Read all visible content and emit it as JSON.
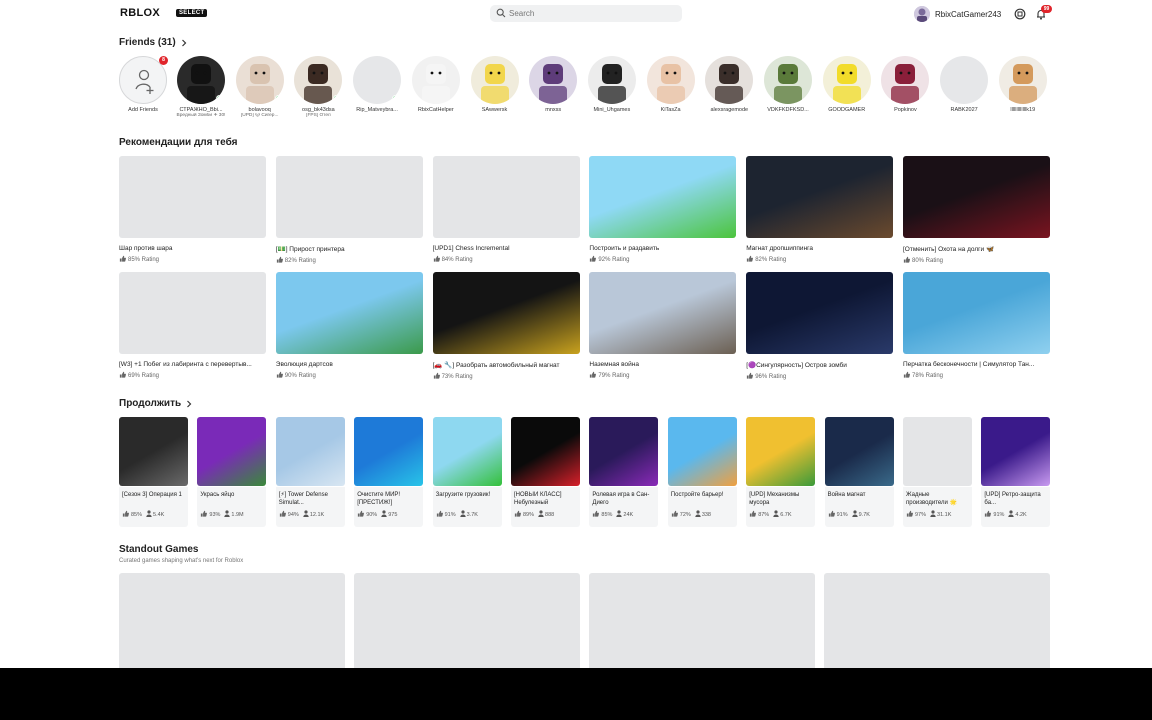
{
  "header": {
    "logo": "RBLOX",
    "logo_badge": "SELECT",
    "search_placeholder": "Search",
    "username": "RbixCatGamer243",
    "notification_count": "99"
  },
  "friends": {
    "title": "Friends (31)",
    "add_label": "Add Friends",
    "add_badge": "8",
    "items": [
      {
        "name": "СТРАЖНО_Bbi...",
        "status": "Вредный Зомби ✈ 30!",
        "online": true,
        "bg": "#2a2a2a",
        "face": "#111"
      },
      {
        "name": "bolavooq",
        "status": "[UPD] 🐱 Сигер...",
        "online": true,
        "bg": "#eadfd5",
        "face": "#d9c3b0"
      },
      {
        "name": "osg_bk43dsa",
        "status": "[FPS] Отел",
        "online": true,
        "bg": "#e9e2d8",
        "face": "#3b2a22"
      },
      {
        "name": "Rip_Matveybra...",
        "status": "",
        "online": true,
        "bg": "#e6e7e9",
        "face": "#e6e7e9"
      },
      {
        "name": "RbixCatHelper",
        "status": "",
        "online": false,
        "bg": "#f1f1f1",
        "face": "#f5f5f5"
      },
      {
        "name": "SAwwersk",
        "status": "",
        "online": false,
        "bg": "#f0ecdc",
        "face": "#f2d64b"
      },
      {
        "name": "mnxss",
        "status": "",
        "online": false,
        "bg": "#dcd6e6",
        "face": "#5e3c7a"
      },
      {
        "name": "Mini_Uhgames",
        "status": "",
        "online": false,
        "bg": "#ececec",
        "face": "#222"
      },
      {
        "name": "KiTasZa",
        "status": "",
        "online": false,
        "bg": "#f2e5dc",
        "face": "#e8c2a5"
      },
      {
        "name": "alexsragemode",
        "status": "",
        "online": false,
        "bg": "#e5e0dc",
        "face": "#3a2e2a"
      },
      {
        "name": "VDKFKDFKSD...",
        "status": "",
        "online": false,
        "bg": "#dde6d7",
        "face": "#5a7a3a"
      },
      {
        "name": "GOODGAMER",
        "status": "",
        "online": false,
        "bg": "#f3f0d8",
        "face": "#f2dc2a"
      },
      {
        "name": "Popkinov",
        "status": "",
        "online": false,
        "bg": "#efe2e6",
        "face": "#8a1f3a"
      },
      {
        "name": "RABK2027",
        "status": "",
        "online": false,
        "bg": "#e6e7e9",
        "face": "#e6e7e9"
      },
      {
        "name": "lllllllllllllk19",
        "status": "",
        "online": false,
        "bg": "#f0ece4",
        "face": "#d49a5c"
      }
    ]
  },
  "recommended": {
    "title": "Рекомендации для тебя",
    "items": [
      {
        "title": "Шар против шара",
        "rating": "85% Rating",
        "c1": "#e4e5e7",
        "c2": "#e4e5e7"
      },
      {
        "title": "[💵] Прирост принтера",
        "rating": "82% Rating",
        "c1": "#e4e5e7",
        "c2": "#e4e5e7"
      },
      {
        "title": "[UPD1] Chess Incremental",
        "rating": "84% Rating",
        "c1": "#e4e5e7",
        "c2": "#e4e5e7"
      },
      {
        "title": "Построить и раздавить",
        "rating": "92% Rating",
        "c1": "#8fd9f5",
        "c2": "#4cc43c"
      },
      {
        "title": "Магнат дропшиппинга",
        "rating": "82% Rating",
        "c1": "#1d2430",
        "c2": "#6b4a2e"
      },
      {
        "title": "[Отменить] Охота на долги 🦋",
        "rating": "80% Rating",
        "c1": "#1a1016",
        "c2": "#7a1420"
      },
      {
        "title": "[W3] +1 Побег из лабиринта с перевертыв...",
        "rating": "69% Rating",
        "c1": "#e4e5e7",
        "c2": "#e4e5e7"
      },
      {
        "title": "Эволюция дартсов",
        "rating": "90% Rating",
        "c1": "#7cc8ee",
        "c2": "#3b9a4a"
      },
      {
        "title": "[🚗 🔧] Разобрать автомобильный магнат",
        "rating": "73% Rating",
        "c1": "#141414",
        "c2": "#c9a21e"
      },
      {
        "title": "Наземная война",
        "rating": "79% Rating",
        "c1": "#b9c7d8",
        "c2": "#6b5f52"
      },
      {
        "title": "[🟣Сингулярность] Остров зомби",
        "rating": "96% Rating",
        "c1": "#0e1734",
        "c2": "#2a3a6a"
      },
      {
        "title": "Перчатка бесконечности | Симулятор Тан...",
        "rating": "78% Rating",
        "c1": "#4aa6d8",
        "c2": "#8fd0ef"
      }
    ]
  },
  "continue": {
    "title": "Продолжить",
    "items": [
      {
        "title": "[Сезон 3] Операция 1",
        "rating": "85%",
        "players": "5.4K",
        "c1": "#2a2a2a",
        "c2": "#6a6a6a"
      },
      {
        "title": "Укрась яйцо",
        "rating": "93%",
        "players": "1.9M",
        "c1": "#7a2ab8",
        "c2": "#3a8a3a"
      },
      {
        "title": "[⚡] Tower Defense Simulat...",
        "rating": "94%",
        "players": "12.1K",
        "c1": "#a6c8e6",
        "c2": "#d8e6f2"
      },
      {
        "title": "Очистите МИР! [ПРЕСТИЖ!]",
        "rating": "90%",
        "players": "975",
        "c1": "#1e7ad8",
        "c2": "#28c4e8"
      },
      {
        "title": "Загрузите грузовик!",
        "rating": "91%",
        "players": "3.7K",
        "c1": "#8ed8f0",
        "c2": "#34c03a"
      },
      {
        "title": "[НОВЫЙ КЛАСС] Небулезный",
        "rating": "89%",
        "players": "888",
        "c1": "#0a0a0a",
        "c2": "#d8202a"
      },
      {
        "title": "Ролевая игра в Сан-Диего",
        "rating": "85%",
        "players": "24K",
        "c1": "#2a1a5a",
        "c2": "#8a2ab8"
      },
      {
        "title": "Постройте барьер!",
        "rating": "72%",
        "players": "338",
        "c1": "#5ab8ee",
        "c2": "#f0a040"
      },
      {
        "title": "[UPD] Механизмы мусора",
        "rating": "87%",
        "players": "6.7K",
        "c1": "#f0c030",
        "c2": "#3a9a3a"
      },
      {
        "title": "Война магнат",
        "rating": "91%",
        "players": "9.7K",
        "c1": "#1a2a4a",
        "c2": "#3a6a8a"
      },
      {
        "title": "Жадные производители 🌟",
        "rating": "97%",
        "players": "31.1K",
        "c1": "#e4e5e7",
        "c2": "#e4e5e7"
      },
      {
        "title": "[UPD] Ретро-защита ба...",
        "rating": "91%",
        "players": "4.2K",
        "c1": "#3a1a8a",
        "c2": "#c89af0"
      }
    ]
  },
  "standout": {
    "title": "Standout Games",
    "subtitle": "Curated games shaping what's next for Roblox"
  }
}
